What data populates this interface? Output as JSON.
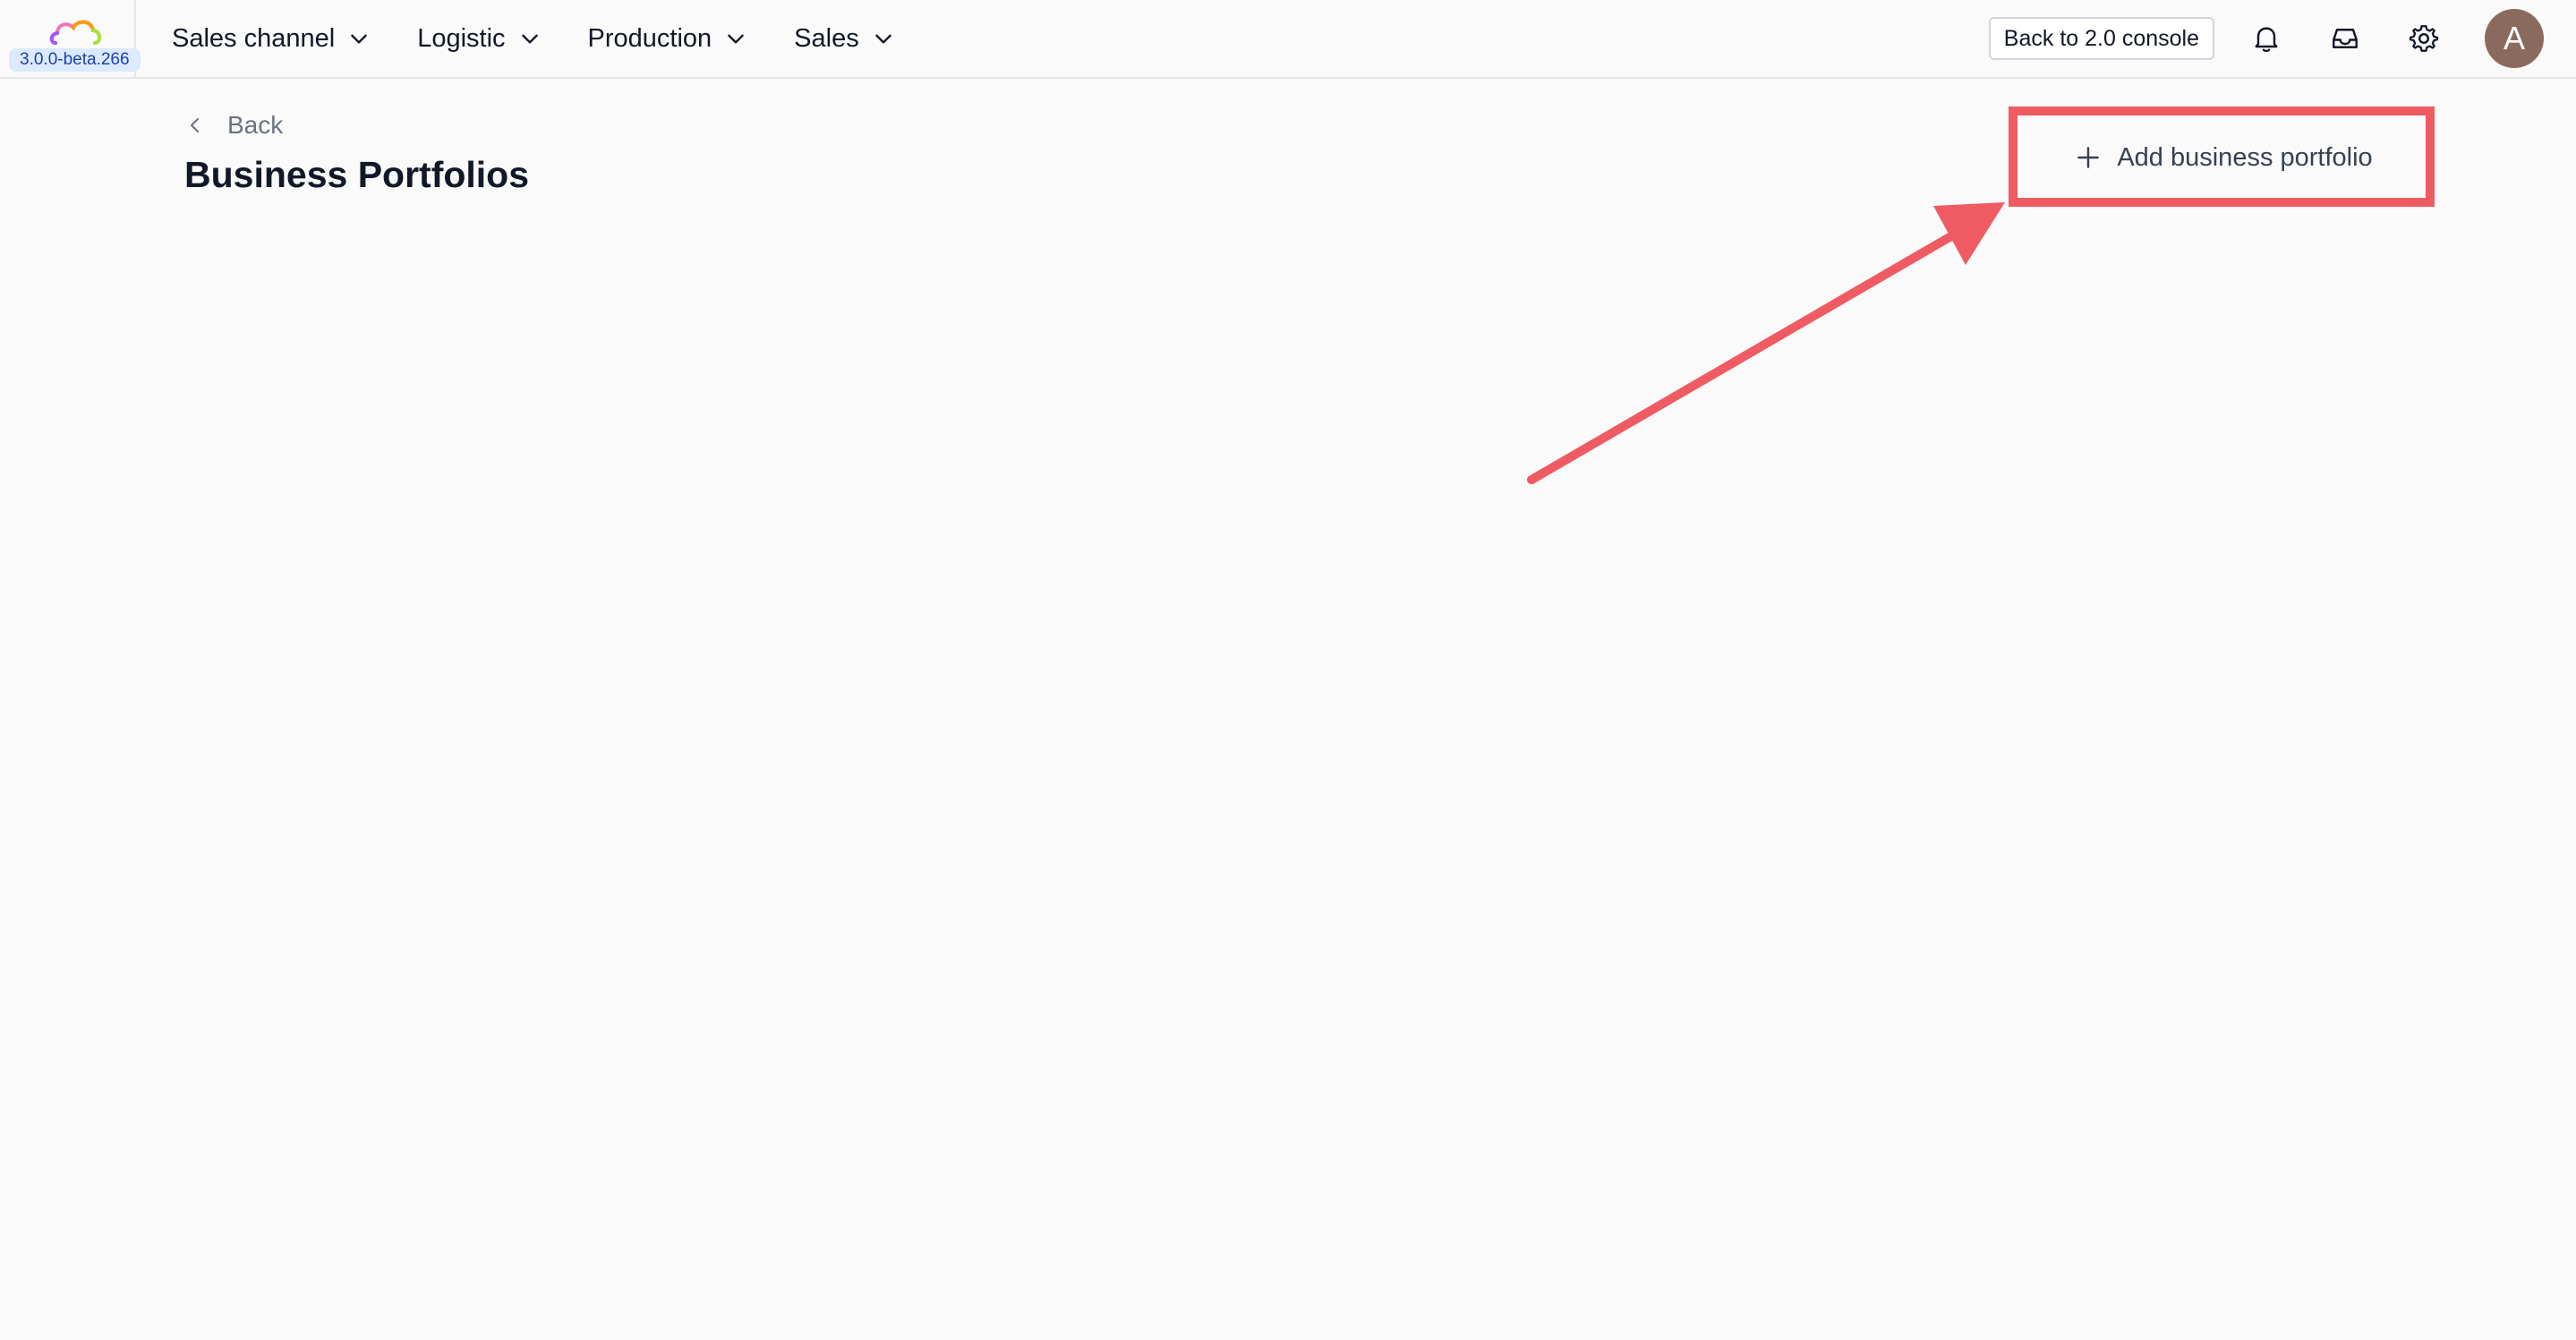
{
  "app": {
    "version": "3.0.0-beta.266",
    "logo_icon": "cloud-logo-icon"
  },
  "nav": {
    "items": [
      {
        "label": "Sales channel",
        "icon": "chevron-down-icon"
      },
      {
        "label": "Logistic",
        "icon": "chevron-down-icon"
      },
      {
        "label": "Production",
        "icon": "chevron-down-icon"
      },
      {
        "label": "Sales",
        "icon": "chevron-down-icon"
      }
    ]
  },
  "toolbar": {
    "console_label": "Back to 2.0 console",
    "icons": [
      "bell-icon",
      "inbox-icon",
      "gear-icon"
    ],
    "avatar_initial": "A",
    "avatar_color": "#8b6a5e"
  },
  "page": {
    "back_label": "Back",
    "title": "Business Portfolios",
    "add_button_label": "Add business portfolio"
  },
  "annotation": {
    "color": "#ef5b62",
    "shape": "arrow-and-highlight-box"
  }
}
